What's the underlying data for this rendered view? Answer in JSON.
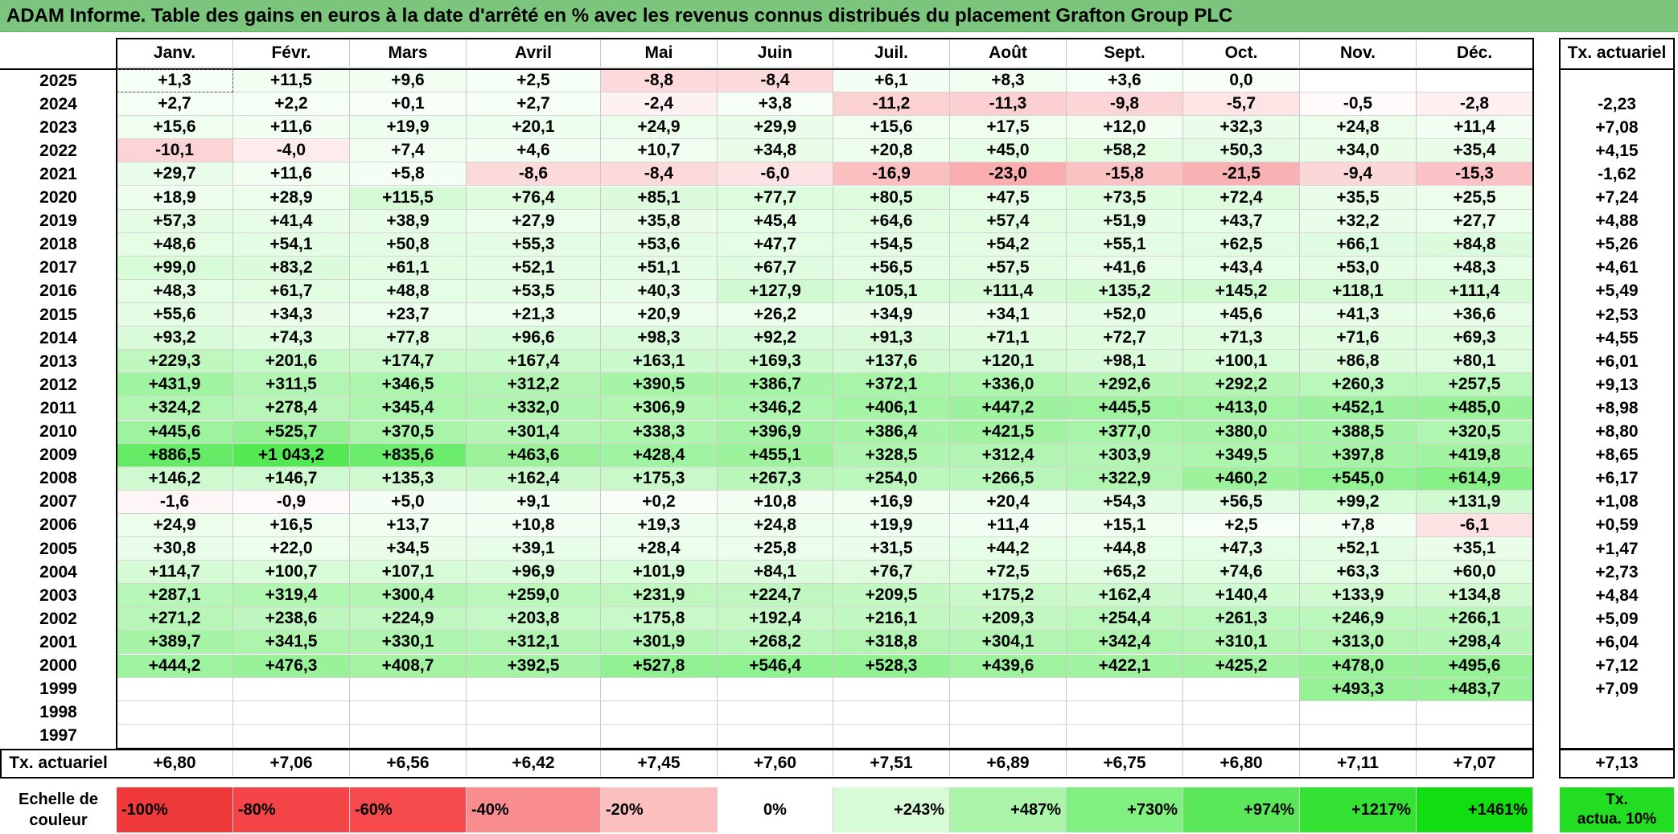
{
  "title": "ADAM Informe. Table des gains en euros à la date d'arrêté en % avec les revenus connus distribués du placement Grafton Group PLC",
  "months": [
    "Janv.",
    "Févr.",
    "Mars",
    "Avril",
    "Mai",
    "Juin",
    "Juil.",
    "Août",
    "Sept.",
    "Oct.",
    "Nov.",
    "Déc."
  ],
  "annual_header": "Tx. actuariel",
  "rows": [
    {
      "year": "2025",
      "cells": [
        "+1,3",
        "+11,5",
        "+9,6",
        "+2,5",
        "-8,8",
        "-8,4",
        "+6,1",
        "+8,3",
        "+3,6",
        "0,0",
        "",
        ""
      ],
      "rate": ""
    },
    {
      "year": "2024",
      "cells": [
        "+2,7",
        "+2,2",
        "+0,1",
        "+2,7",
        "-2,4",
        "+3,8",
        "-11,2",
        "-11,3",
        "-9,8",
        "-5,7",
        "-0,5",
        "-2,8"
      ],
      "rate": "-2,23"
    },
    {
      "year": "2023",
      "cells": [
        "+15,6",
        "+11,6",
        "+19,9",
        "+20,1",
        "+24,9",
        "+29,9",
        "+15,6",
        "+17,5",
        "+12,0",
        "+32,3",
        "+24,8",
        "+11,4"
      ],
      "rate": "+7,08"
    },
    {
      "year": "2022",
      "cells": [
        "-10,1",
        "-4,0",
        "+7,4",
        "+4,6",
        "+10,7",
        "+34,8",
        "+20,8",
        "+45,0",
        "+58,2",
        "+50,3",
        "+34,0",
        "+35,4"
      ],
      "rate": "+4,15"
    },
    {
      "year": "2021",
      "cells": [
        "+29,7",
        "+11,6",
        "+5,8",
        "-8,6",
        "-8,4",
        "-6,0",
        "-16,9",
        "-23,0",
        "-15,8",
        "-21,5",
        "-9,4",
        "-15,3"
      ],
      "rate": "-1,62"
    },
    {
      "year": "2020",
      "cells": [
        "+18,9",
        "+28,9",
        "+115,5",
        "+76,4",
        "+85,1",
        "+77,7",
        "+80,5",
        "+47,5",
        "+73,5",
        "+72,4",
        "+35,5",
        "+25,5"
      ],
      "rate": "+7,24"
    },
    {
      "year": "2019",
      "cells": [
        "+57,3",
        "+41,4",
        "+38,9",
        "+27,9",
        "+35,8",
        "+45,4",
        "+64,6",
        "+57,4",
        "+51,9",
        "+43,7",
        "+32,2",
        "+27,7"
      ],
      "rate": "+4,88"
    },
    {
      "year": "2018",
      "cells": [
        "+48,6",
        "+54,1",
        "+50,8",
        "+55,3",
        "+53,6",
        "+47,7",
        "+54,5",
        "+54,2",
        "+55,1",
        "+62,5",
        "+66,1",
        "+84,8"
      ],
      "rate": "+5,26"
    },
    {
      "year": "2017",
      "cells": [
        "+99,0",
        "+83,2",
        "+61,1",
        "+52,1",
        "+51,1",
        "+67,7",
        "+56,5",
        "+57,5",
        "+41,6",
        "+43,4",
        "+53,0",
        "+48,3"
      ],
      "rate": "+4,61"
    },
    {
      "year": "2016",
      "cells": [
        "+48,3",
        "+61,7",
        "+48,8",
        "+53,5",
        "+40,3",
        "+127,9",
        "+105,1",
        "+111,4",
        "+135,2",
        "+145,2",
        "+118,1",
        "+111,4"
      ],
      "rate": "+5,49"
    },
    {
      "year": "2015",
      "cells": [
        "+55,6",
        "+34,3",
        "+23,7",
        "+21,3",
        "+20,9",
        "+26,2",
        "+34,9",
        "+34,1",
        "+52,0",
        "+45,6",
        "+41,3",
        "+36,6"
      ],
      "rate": "+2,53"
    },
    {
      "year": "2014",
      "cells": [
        "+93,2",
        "+74,3",
        "+77,8",
        "+96,6",
        "+98,3",
        "+92,2",
        "+91,3",
        "+71,1",
        "+72,7",
        "+71,3",
        "+71,6",
        "+69,3"
      ],
      "rate": "+4,55"
    },
    {
      "year": "2013",
      "cells": [
        "+229,3",
        "+201,6",
        "+174,7",
        "+167,4",
        "+163,1",
        "+169,3",
        "+137,6",
        "+120,1",
        "+98,1",
        "+100,1",
        "+86,8",
        "+80,1"
      ],
      "rate": "+6,01"
    },
    {
      "year": "2012",
      "cells": [
        "+431,9",
        "+311,5",
        "+346,5",
        "+312,2",
        "+390,5",
        "+386,7",
        "+372,1",
        "+336,0",
        "+292,6",
        "+292,2",
        "+260,3",
        "+257,5"
      ],
      "rate": "+9,13"
    },
    {
      "year": "2011",
      "cells": [
        "+324,2",
        "+278,4",
        "+345,4",
        "+332,0",
        "+306,9",
        "+346,2",
        "+406,1",
        "+447,2",
        "+445,5",
        "+413,0",
        "+452,1",
        "+485,0"
      ],
      "rate": "+8,98"
    },
    {
      "year": "2010",
      "cells": [
        "+445,6",
        "+525,7",
        "+370,5",
        "+301,4",
        "+338,3",
        "+396,9",
        "+386,4",
        "+421,5",
        "+377,0",
        "+380,0",
        "+388,5",
        "+320,5"
      ],
      "rate": "+8,80"
    },
    {
      "year": "2009",
      "cells": [
        "+886,5",
        "+1 043,2",
        "+835,6",
        "+463,6",
        "+428,4",
        "+455,1",
        "+328,5",
        "+312,4",
        "+303,9",
        "+349,5",
        "+397,8",
        "+419,8"
      ],
      "rate": "+8,65"
    },
    {
      "year": "2008",
      "cells": [
        "+146,2",
        "+146,7",
        "+135,3",
        "+162,4",
        "+175,3",
        "+267,3",
        "+254,0",
        "+266,5",
        "+322,9",
        "+460,2",
        "+545,0",
        "+614,9"
      ],
      "rate": "+6,17"
    },
    {
      "year": "2007",
      "cells": [
        "-1,6",
        "-0,9",
        "+5,0",
        "+9,1",
        "+0,2",
        "+10,8",
        "+16,9",
        "+20,4",
        "+54,3",
        "+56,5",
        "+99,2",
        "+131,9"
      ],
      "rate": "+1,08"
    },
    {
      "year": "2006",
      "cells": [
        "+24,9",
        "+16,5",
        "+13,7",
        "+10,8",
        "+19,3",
        "+24,8",
        "+19,9",
        "+11,4",
        "+15,1",
        "+2,5",
        "+7,8",
        "-6,1"
      ],
      "rate": "+0,59"
    },
    {
      "year": "2005",
      "cells": [
        "+30,8",
        "+22,0",
        "+34,5",
        "+39,1",
        "+28,4",
        "+25,8",
        "+31,5",
        "+44,2",
        "+44,8",
        "+47,3",
        "+52,1",
        "+35,1"
      ],
      "rate": "+1,47"
    },
    {
      "year": "2004",
      "cells": [
        "+114,7",
        "+100,7",
        "+107,1",
        "+96,9",
        "+101,9",
        "+84,1",
        "+76,7",
        "+72,5",
        "+65,2",
        "+74,6",
        "+63,3",
        "+60,0"
      ],
      "rate": "+2,73"
    },
    {
      "year": "2003",
      "cells": [
        "+287,1",
        "+319,4",
        "+300,4",
        "+259,0",
        "+231,9",
        "+224,7",
        "+209,5",
        "+175,2",
        "+162,4",
        "+140,4",
        "+133,9",
        "+134,8"
      ],
      "rate": "+4,84"
    },
    {
      "year": "2002",
      "cells": [
        "+271,2",
        "+238,6",
        "+224,9",
        "+203,8",
        "+175,8",
        "+192,4",
        "+216,1",
        "+209,3",
        "+254,4",
        "+261,3",
        "+246,9",
        "+266,1"
      ],
      "rate": "+5,09"
    },
    {
      "year": "2001",
      "cells": [
        "+389,7",
        "+341,5",
        "+330,1",
        "+312,1",
        "+301,9",
        "+268,2",
        "+318,8",
        "+304,1",
        "+342,4",
        "+310,1",
        "+313,0",
        "+298,4"
      ],
      "rate": "+6,04"
    },
    {
      "year": "2000",
      "cells": [
        "+444,2",
        "+476,3",
        "+408,7",
        "+392,5",
        "+527,8",
        "+546,4",
        "+528,3",
        "+439,6",
        "+422,1",
        "+425,2",
        "+478,0",
        "+495,6"
      ],
      "rate": "+7,12"
    },
    {
      "year": "1999",
      "cells": [
        "",
        "",
        "",
        "",
        "",
        "",
        "",
        "",
        "",
        "",
        "+493,3",
        "+483,7"
      ],
      "rate": "+7,09"
    },
    {
      "year": "1998",
      "cells": [
        "",
        "",
        "",
        "",
        "",
        "",
        "",
        "",
        "",
        "",
        "",
        ""
      ],
      "rate": ""
    },
    {
      "year": "1997",
      "cells": [
        "",
        "",
        "",
        "",
        "",
        "",
        "",
        "",
        "",
        "",
        "",
        ""
      ],
      "rate": ""
    }
  ],
  "footer": {
    "label": "Tx. actuariel",
    "cells": [
      "+6,80",
      "+7,06",
      "+6,56",
      "+6,42",
      "+7,45",
      "+7,60",
      "+7,51",
      "+6,89",
      "+6,75",
      "+6,80",
      "+7,11",
      "+7,07"
    ],
    "rate": "+7,13"
  },
  "scale": {
    "label_line1": "Echelle de",
    "label_line2": "couleur",
    "steps": [
      {
        "text": "-100%",
        "color": "#f0393b",
        "align": "left"
      },
      {
        "text": "-80%",
        "color": "#f44447",
        "align": "left"
      },
      {
        "text": "-60%",
        "color": "#f64a4d",
        "align": "left"
      },
      {
        "text": "-40%",
        "color": "#f88c8e",
        "align": "left"
      },
      {
        "text": "-20%",
        "color": "#fbbfc0",
        "align": "left"
      },
      {
        "text": "0%",
        "color": "#ffffff",
        "align": "center"
      },
      {
        "text": "+243%",
        "color": "#d6fbd6",
        "align": "right"
      },
      {
        "text": "+487%",
        "color": "#aaf5aa",
        "align": "right"
      },
      {
        "text": "+730%",
        "color": "#80f080",
        "align": "right"
      },
      {
        "text": "+974%",
        "color": "#5ae85a",
        "align": "right"
      },
      {
        "text": "+1217%",
        "color": "#33e233",
        "align": "right"
      },
      {
        "text": "+1461%",
        "color": "#11dd11",
        "align": "right"
      }
    ],
    "rate_box_line1": "Tx.",
    "rate_box_line2": "actua. 10%",
    "rate_box_color": "#22dd22"
  },
  "colors": {
    "title_bg": "#7cc57c",
    "negative": "#f6434a",
    "positive": "#22dd22",
    "neutral": "#ffffff"
  }
}
